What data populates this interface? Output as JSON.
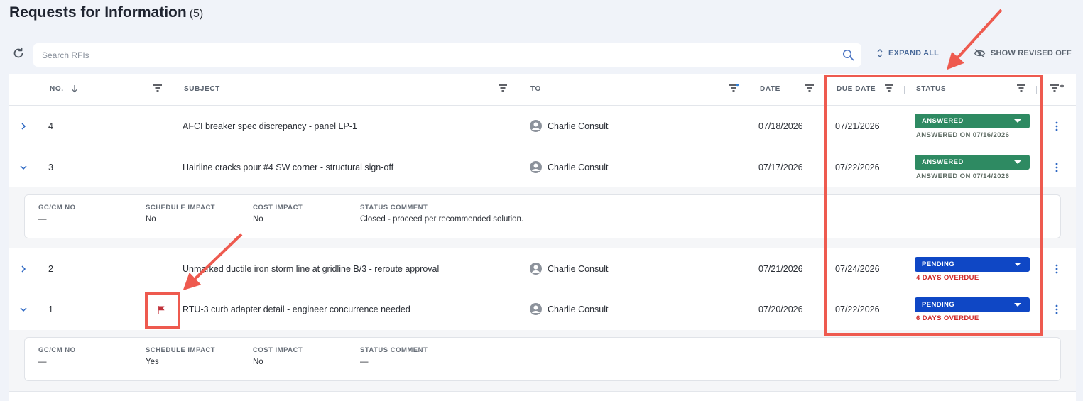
{
  "header": {
    "title": "Requests for Information",
    "count": "(5)"
  },
  "toolbar": {
    "search_placeholder": "Search RFIs",
    "expand_all": "EXPAND ALL",
    "show_revised": "SHOW REVISED OFF"
  },
  "columns": {
    "no": "NO.",
    "subject": "SUBJECT",
    "to": "TO",
    "date": "DATE",
    "due_date": "DUE DATE",
    "status": "STATUS"
  },
  "rows": [
    {
      "no": "4",
      "subject": "AFCI breaker spec discrepancy - panel LP-1",
      "to": "Charlie Consult",
      "date": "07/18/2026",
      "due": "07/21/2026",
      "status": "ANSWERED",
      "status_sub": "ANSWERED ON 07/16/2026",
      "expanded": false,
      "flagged": false
    },
    {
      "no": "3",
      "subject": "Hairline cracks pour #4 SW corner - structural sign-off",
      "to": "Charlie Consult",
      "date": "07/17/2026",
      "due": "07/22/2026",
      "status": "ANSWERED",
      "status_sub": "ANSWERED ON 07/14/2026",
      "expanded": true,
      "flagged": false
    },
    {
      "no": "2",
      "subject": "Unmarked ductile iron storm line at gridline B/3 - reroute approval",
      "to": "Charlie Consult",
      "date": "07/21/2026",
      "due": "07/24/2026",
      "status": "PENDING",
      "status_sub": "4 DAYS OVERDUE",
      "expanded": false,
      "flagged": false
    },
    {
      "no": "1",
      "subject": "RTU-3 curb adapter detail - engineer concurrence needed",
      "to": "Charlie Consult",
      "date": "07/20/2026",
      "due": "07/22/2026",
      "status": "PENDING",
      "status_sub": "6 DAYS OVERDUE",
      "expanded": true,
      "flagged": true
    }
  ],
  "details": {
    "labels": {
      "gc": "GC/CM NO",
      "schedule": "SCHEDULE IMPACT",
      "cost": "COST IMPACT",
      "comment": "STATUS COMMENT"
    },
    "rfi3": {
      "gc": "—",
      "schedule": "No",
      "cost": "No",
      "comment": "Closed - proceed per recommended solution."
    },
    "rfi1": {
      "gc": "—",
      "schedule": "Yes",
      "cost": "No",
      "comment": "—"
    }
  },
  "colors": {
    "answered": "#2e8a62",
    "pending": "#0f47c5",
    "overdue": "#cf2b2b",
    "annotation": "#ee5a4f",
    "flag": "#c0303a"
  },
  "icons": [
    "refresh-icon",
    "search-icon",
    "expand-icon",
    "eye-off-icon",
    "filter-icon",
    "sort-arrow-icon",
    "chevron-right-icon",
    "chevron-down-icon",
    "person-icon",
    "flag-icon",
    "kebab-icon",
    "column-settings-icon"
  ]
}
